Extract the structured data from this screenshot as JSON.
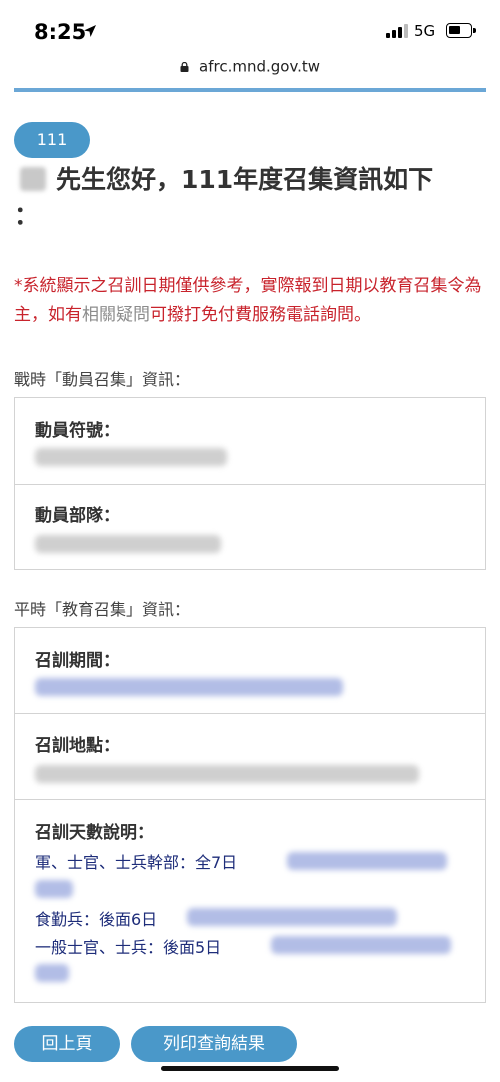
{
  "status": {
    "time": "8:25",
    "network": "5G"
  },
  "browser": {
    "url": "afrc.mnd.gov.tw"
  },
  "page": {
    "year_badge": "111",
    "greeting": "先生您好，111年度召集資訊如下",
    "greeting_colon": "：",
    "notice_part1": "*系統顯示之召訓日期僅供參考，實際報到日期以教育召集令為主，如有",
    "notice_muted": "相關疑問",
    "notice_part2": "可撥打免付費服務電話詢問。",
    "wartime_title": "戰時「動員召集」資訊：",
    "peacetime_title": "平時「教育召集」資訊：",
    "mobilization_code_label": "動員符號：",
    "mobilization_unit_label": "動員部隊：",
    "training_period_label": "召訓期間：",
    "training_location_label": "召訓地點：",
    "training_days_label": "召訓天數說明：",
    "days_officers": "軍、士官、士兵幹部：全7日",
    "days_logistics": "食勤兵：後面6日",
    "days_general": "一般士官、士兵：後面5日"
  },
  "buttons": {
    "back": "回上頁",
    "print": "列印查詢結果"
  }
}
